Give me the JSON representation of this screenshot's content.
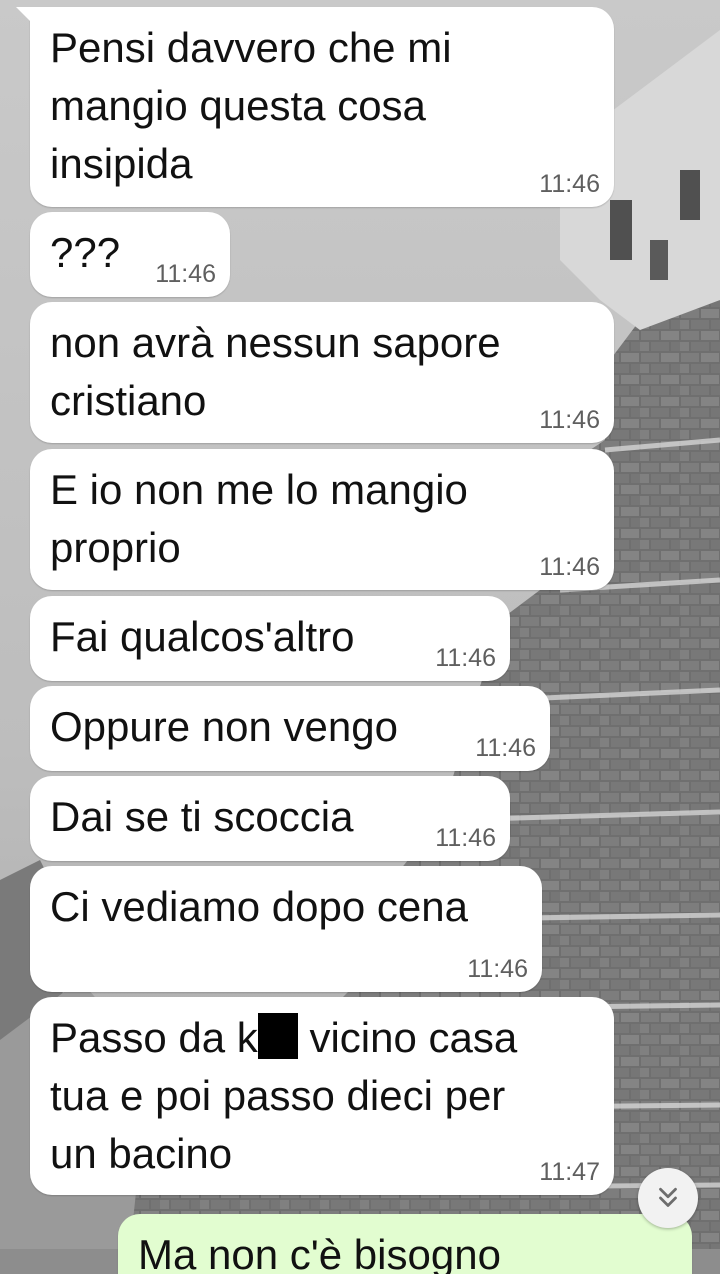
{
  "messages": [
    {
      "text": "Pensi davvero che mi\nmangio questa cosa\ninsipida",
      "time": "11:46"
    },
    {
      "text": "???",
      "time": "11:46"
    },
    {
      "text": "non avrà nessun sapore\ncristiano",
      "time": "11:46"
    },
    {
      "text": "E io non me lo mangio\nproprio",
      "time": "11:46"
    },
    {
      "text": "Fai qualcos'altro",
      "time": "11:46"
    },
    {
      "text": "Oppure non vengo",
      "time": "11:46"
    },
    {
      "text": "Dai se ti scoccia",
      "time": "11:46"
    },
    {
      "text": "Ci vediamo dopo cena",
      "time": "11:46"
    },
    {
      "text_before": "Passo da k",
      "text_after": " vicino casa\ntua e poi passo dieci per\nun bacino",
      "time": "11:47"
    }
  ],
  "outgoing_partial": {
    "text": "Ma non c'è bisogno"
  },
  "scroll_button": {
    "icon": "double-chevron-down-icon"
  },
  "colors": {
    "incoming_bubble": "#ffffff",
    "outgoing_bubble": "#e2fdd0",
    "time": "#5f5f5f"
  }
}
